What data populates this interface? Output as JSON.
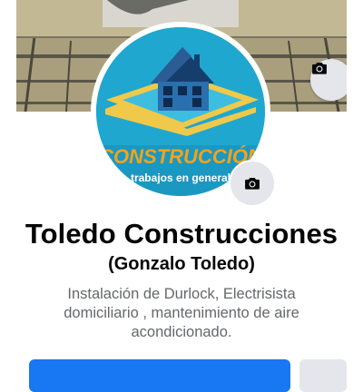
{
  "profile": {
    "name": "Toledo Construcciones",
    "alternate_name": "(Gonzalo Toledo)",
    "bio": "Instalación de Durlock, Electrisista domiciliario , mantenimiento de aire acondicionado."
  },
  "cover_photo": {
    "camera_icon": "camera-icon"
  },
  "profile_picture": {
    "logo_text": "CONSTRUCCIÓN",
    "logo_subtext": "trabajos en general",
    "camera_icon": "camera-icon"
  },
  "colors": {
    "primary": "#1877f2",
    "secondary_button": "#e4e6eb",
    "name_text": "#050505",
    "bio_text": "#65676b",
    "logo_background": "#1fa7cf",
    "logo_text": "#f5a21b"
  }
}
